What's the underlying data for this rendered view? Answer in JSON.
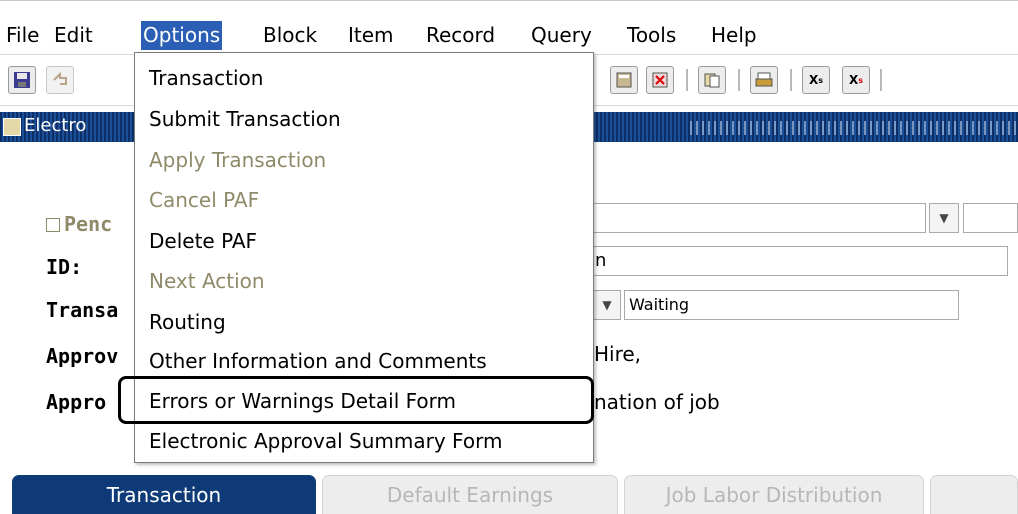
{
  "menubar": {
    "items": [
      {
        "label": "File"
      },
      {
        "label": "Edit"
      },
      {
        "label": "Options"
      },
      {
        "label": "Block"
      },
      {
        "label": "Item"
      },
      {
        "label": "Record"
      },
      {
        "label": "Query"
      },
      {
        "label": "Tools"
      },
      {
        "label": "Help"
      }
    ]
  },
  "window": {
    "title": "Electro"
  },
  "form": {
    "pending_label": "Penc",
    "id_label": "ID:",
    "transaction_label": "Transa",
    "status_value": "Waiting",
    "approval1_label": "Approv",
    "approval1_value": "Hire,",
    "approval2_label": "Appro",
    "approval2_value": "nation of job",
    "id_value_tail": "n"
  },
  "options_menu": {
    "items": [
      {
        "label": "Transaction",
        "enabled": true
      },
      {
        "label": "Submit Transaction",
        "enabled": true
      },
      {
        "label": "Apply Transaction",
        "enabled": false
      },
      {
        "label": "Cancel PAF",
        "enabled": false
      },
      {
        "label": "Delete PAF",
        "enabled": true
      },
      {
        "label": "Next Action",
        "enabled": false
      },
      {
        "label": "Routing",
        "enabled": true
      },
      {
        "label": "Other Information and Comments",
        "enabled": true
      },
      {
        "label": "Errors or Warnings Detail Form",
        "enabled": true,
        "highlighted": true
      },
      {
        "label": "Electronic Approval Summary Form",
        "enabled": true
      }
    ]
  },
  "tabs": [
    {
      "label": "Transaction",
      "active": true
    },
    {
      "label": "Default Earnings",
      "active": false
    },
    {
      "label": "Job Labor Distribution",
      "active": false
    }
  ],
  "icons": {
    "save": "save-icon",
    "rollback": "rollback-icon",
    "calc": "calculator-icon",
    "remove": "remove-record-icon",
    "copy": "copy-icon",
    "print": "print-icon",
    "x1": "x-sub-icon",
    "x2": "x-sup-icon"
  }
}
